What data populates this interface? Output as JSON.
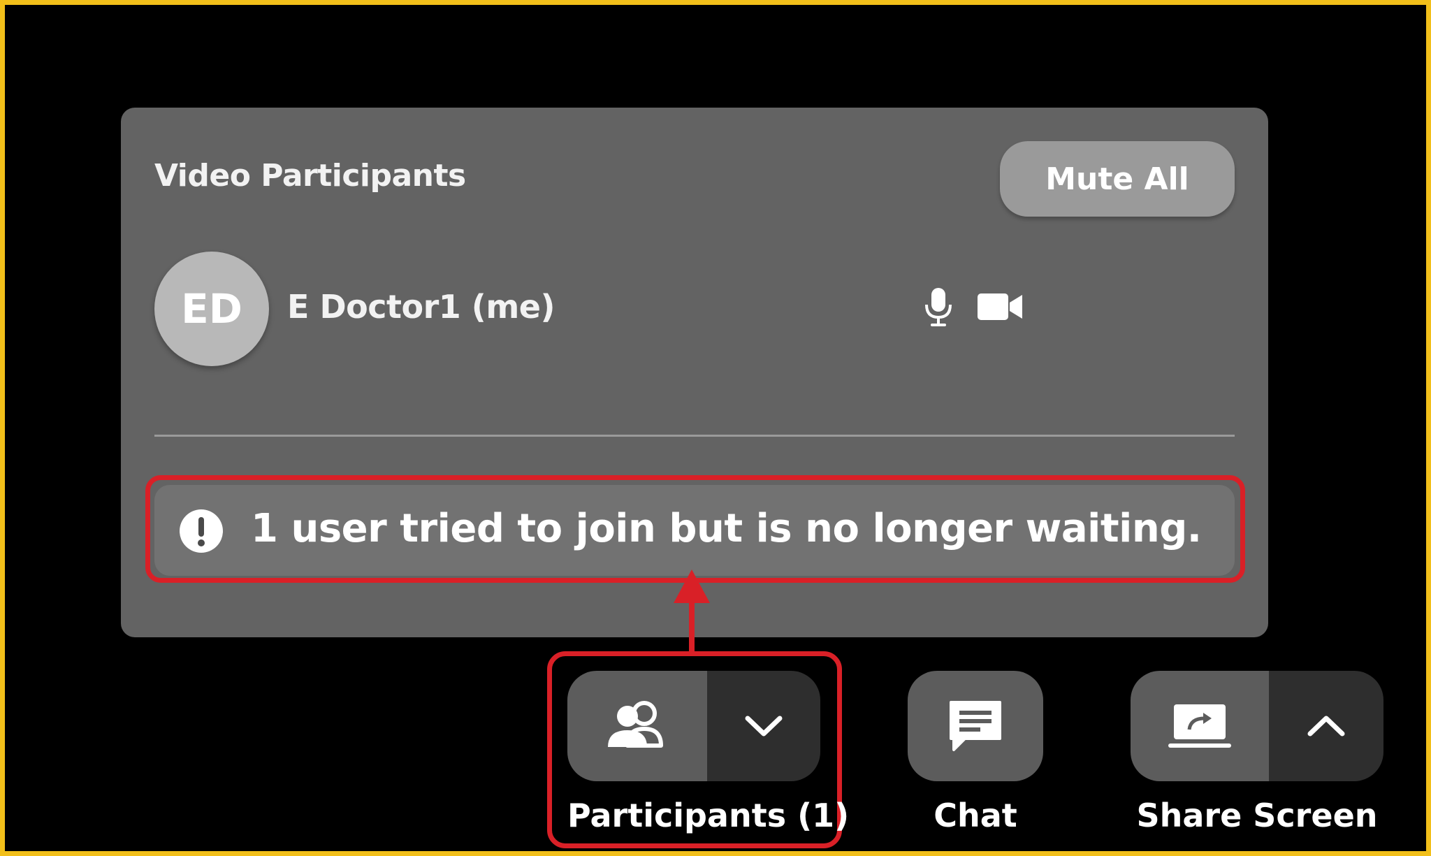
{
  "panel": {
    "title": "Video Participants",
    "mute_all_label": "Mute All",
    "participant": {
      "initials": "ED",
      "name": "E Doctor1 (me)",
      "icons": [
        "microphone-icon",
        "video-camera-icon"
      ]
    },
    "notice": {
      "icon": "exclamation-circle-icon",
      "text": "1 user tried to join but is no longer waiting."
    }
  },
  "controls": {
    "participants": {
      "label": "Participants (1)",
      "icon": "users-icon",
      "dropdown_icon": "chevron-down-icon"
    },
    "chat": {
      "label": "Chat",
      "icon": "chat-icon"
    },
    "share_screen": {
      "label": "Share Screen",
      "icon": "share-screen-icon",
      "options_icon": "chevron-up-icon"
    }
  },
  "colors": {
    "frame_border": "#f2bf1a",
    "annotation": "#d92027",
    "panel_bg": "#636363",
    "background": "#000000"
  }
}
